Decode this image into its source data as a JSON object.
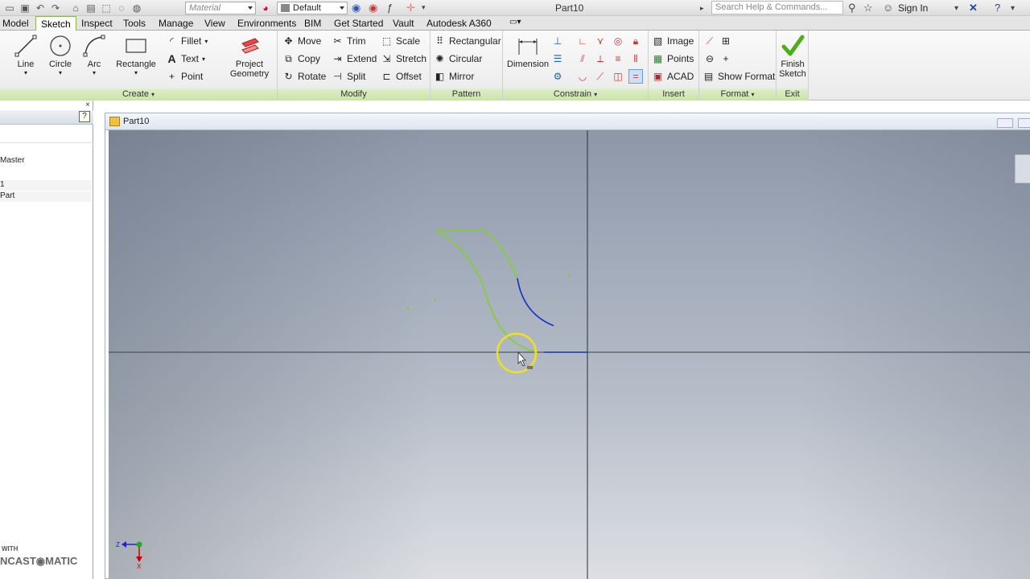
{
  "titlebar": {
    "material_value": "Material",
    "appearance_value": "Default",
    "doc_title": "Part10",
    "search_placeholder": "Search Help & Commands...",
    "signin_label": "Sign In"
  },
  "tabs": [
    {
      "label": "Model"
    },
    {
      "label": "Sketch"
    },
    {
      "label": "Inspect"
    },
    {
      "label": "Tools"
    },
    {
      "label": "Manage"
    },
    {
      "label": "View"
    },
    {
      "label": "Environments"
    },
    {
      "label": "BIM"
    },
    {
      "label": "Get Started"
    },
    {
      "label": "Vault"
    },
    {
      "label": "Autodesk A360"
    }
  ],
  "ribbon": {
    "create": {
      "title": "Create",
      "line": "Line",
      "circle": "Circle",
      "arc": "Arc",
      "rectangle": "Rectangle",
      "fillet": "Fillet",
      "text": "Text",
      "point": "Point",
      "project_geometry_1": "Project",
      "project_geometry_2": "Geometry"
    },
    "modify": {
      "title": "Modify",
      "move": "Move",
      "copy": "Copy",
      "rotate": "Rotate",
      "trim": "Trim",
      "extend": "Extend",
      "split": "Split",
      "scale": "Scale",
      "stretch": "Stretch",
      "offset": "Offset"
    },
    "pattern": {
      "title": "Pattern",
      "rectangular": "Rectangular",
      "circular": "Circular",
      "mirror": "Mirror"
    },
    "constrain": {
      "title": "Constrain",
      "dimension": "Dimension"
    },
    "insert": {
      "title": "Insert",
      "image": "Image",
      "points": "Points",
      "acad": "ACAD"
    },
    "format": {
      "title": "Format",
      "show_format": "Show Format"
    },
    "exit": {
      "title": "Exit",
      "finish_1": "Finish",
      "finish_2": "Sketch"
    }
  },
  "browser": {
    "help_glyph": "?",
    "close_glyph": "×",
    "rows": [
      "Master",
      "1",
      "Part"
    ]
  },
  "graphics": {
    "window_title": "Part10"
  },
  "watermark": {
    "with": "WITH",
    "brand": "NCAST◉MATIC"
  },
  "colors": {
    "sketch_green": "#7ed321",
    "sketch_blue": "#1030c8",
    "cursor_highlight": "#f0e020",
    "ribbon_accent": "#c9e3a6",
    "finish_check": "#4caf1a"
  }
}
